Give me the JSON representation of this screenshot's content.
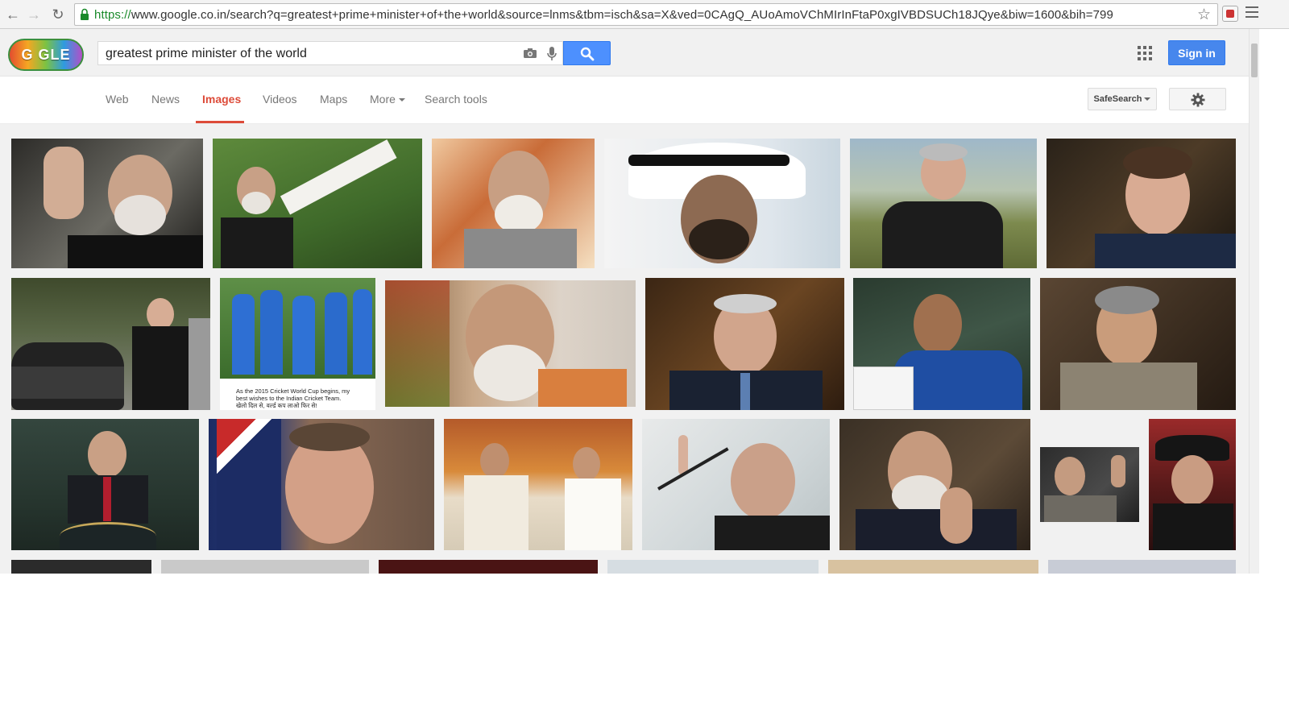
{
  "browser": {
    "url_scheme": "https://",
    "url_rest": "www.google.co.in/search?q=greatest+prime+minister+of+the+world&source=lnms&tbm=isch&sa=X&ved=0CAgQ_AUoAmoVChMIrInFtaP0xgIVBDSUCh18JQye&biw=1600&bih=799",
    "icons": {
      "back": "back-arrow-icon",
      "forward": "forward-arrow-icon",
      "reload": "reload-icon",
      "lock": "lock-icon",
      "star": "bookmark-star-icon",
      "extension": "extension-icon",
      "menu": "hamburger-menu-icon"
    }
  },
  "header": {
    "logo_text": "G  GLE",
    "search_query": "greatest prime minister of the world",
    "sign_in_label": "Sign in",
    "icons": {
      "camera": "camera-icon",
      "mic": "microphone-icon",
      "search": "search-icon",
      "apps": "apps-grid-icon"
    },
    "colors": {
      "search_button": "#4d90fe",
      "sign_in_button": "#4787ed"
    }
  },
  "tabs": {
    "items": [
      {
        "label": "Web"
      },
      {
        "label": "News"
      },
      {
        "label": "Images",
        "active": true
      },
      {
        "label": "Videos"
      },
      {
        "label": "Maps"
      },
      {
        "label": "More",
        "dropdown": true
      },
      {
        "label": "Search tools"
      }
    ],
    "active_color": "#dd4b39",
    "safesearch_label": "SafeSearch",
    "settings_icon": "gear-icon"
  },
  "image_captions": {
    "cricket_line1": "As the 2015 Cricket World Cup begins, my",
    "cricket_line2": "best wishes to the Indian Cricket Team.",
    "cricket_line3": "खेलो दिल से, वर्ल्ड कप लाओ फिर से!"
  }
}
